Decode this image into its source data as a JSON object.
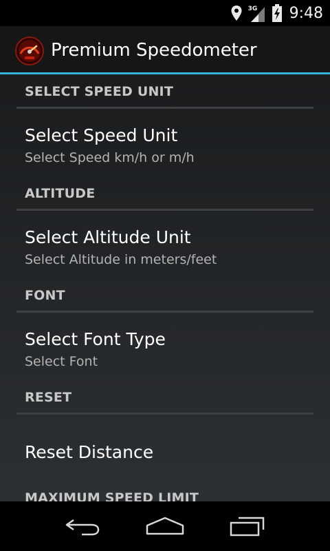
{
  "status_bar": {
    "network_type": "3G",
    "time": "9:48",
    "icons": [
      "location-icon",
      "signal-icon",
      "battery-charging-icon"
    ]
  },
  "action_bar": {
    "app_icon": "speedometer-icon",
    "title": "Premium Speedometer",
    "accent_color": "#35b2e0"
  },
  "preferences": {
    "speed_category": "SELECT SPEED UNIT",
    "speed_unit": {
      "title": "Select Speed Unit",
      "summary": "Select Speed km/h or m/h"
    },
    "altitude_category": "ALTITUDE",
    "altitude_unit": {
      "title": "Select Altitude Unit",
      "summary": "Select Altitude in meters/feet"
    },
    "font_category": "FONT",
    "font_type": {
      "title": "Select Font Type",
      "summary": "Select Font"
    },
    "reset_category": "RESET",
    "reset_distance": {
      "title": "Reset Distance"
    },
    "max_speed_category": "MAXIMUM SPEED LIMIT"
  },
  "nav_bar": {
    "icons": [
      "back-icon",
      "home-icon",
      "recent-apps-icon"
    ]
  }
}
